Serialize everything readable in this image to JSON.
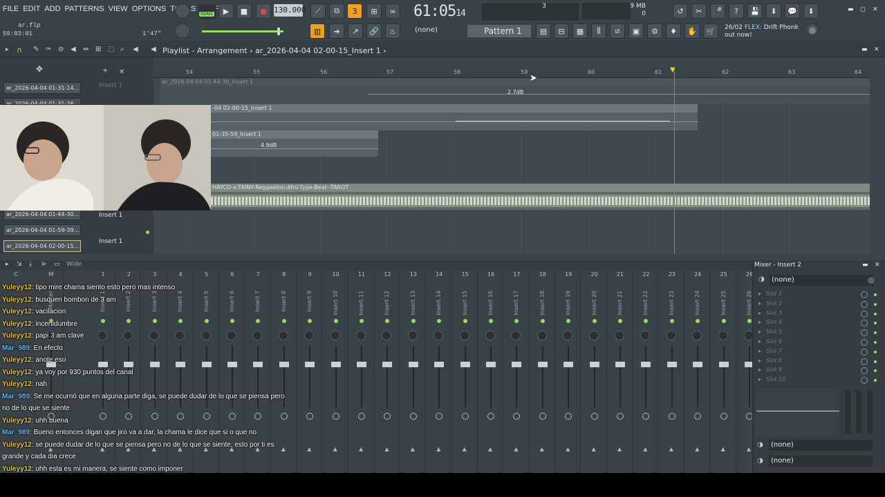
{
  "menu": [
    "FILE",
    "EDIT",
    "ADD",
    "PATTERNS",
    "VIEW",
    "OPTIONS",
    "TOOLS",
    "HELP"
  ],
  "file": {
    "name": "ar.flp",
    "time": "59:03:01",
    "length": "1'47\""
  },
  "transport": {
    "mode": "SONG",
    "tempo": "130.000",
    "clock_main": "61:05",
    "clock_sub": "14"
  },
  "memory": {
    "cpu": "3",
    "ram": "779 MB",
    "poly": "0"
  },
  "pattern": {
    "label": "Pattern 1",
    "preset": "(none)"
  },
  "hint": {
    "date": "26/02",
    "tag": "FLEX:",
    "text": "Drift Phonk",
    "text2": "out now!"
  },
  "playlist": {
    "title": "Playlist - Arrangement",
    "breadcrumb": "ar_2026-04-04 02-00-15_Insert 1",
    "ruler": [
      "54",
      "55",
      "56",
      "57",
      "58",
      "59",
      "60",
      "61",
      "62",
      "63",
      "64"
    ],
    "tracks_side": [
      "ar_2026-04-04 01-31-14...",
      "ar_2026-04-04 01-31-26",
      "ar_2026-04-04 01-44-30...",
      "ar_2026-04-04 01-59-39...",
      "ar_2026-04-04 02-00-15..."
    ],
    "track_labels": [
      "Insert 1",
      "Insert 1",
      "Insert 1"
    ],
    "clips": [
      {
        "name": "ar_2026-04-04 01-44-30_Insert 1",
        "db": "2.7dB"
      },
      {
        "name": "-04 02-00-15_Insert 1"
      },
      {
        "name": "01-35-59_Insert 1",
        "db": "4.9dB"
      },
      {
        "name": "HAYCO-x-TAINY-Reggaeton-Afro-Type-Beat--TAROT"
      }
    ]
  },
  "mixer": {
    "wide_label": "Wide",
    "header": [
      "C",
      "M",
      "1",
      "2",
      "3",
      "4",
      "5",
      "6",
      "7",
      "8",
      "9",
      "10",
      "11",
      "12",
      "13",
      "14",
      "15",
      "16",
      "17",
      "18",
      "19",
      "20",
      "21",
      "22",
      "23",
      "24",
      "25",
      "26"
    ],
    "names": [
      "Master",
      "Insert 1",
      "Insert 2",
      "Insert 3",
      "Insert 4",
      "Insert 5",
      "Insert 6",
      "Insert 7",
      "Insert 8",
      "Insert 9",
      "Insert 10",
      "Insert 11",
      "Insert 12",
      "Insert 13",
      "Insert 14",
      "Insert 15",
      "Insert 16",
      "Insert 17",
      "Insert 18",
      "Insert 19",
      "Insert 20",
      "Insert 21",
      "Insert 22",
      "Insert 23",
      "Insert 24",
      "Insert 25",
      "Insert 26"
    ],
    "panel_title": "Mixer - Insert 2",
    "panel_preset": "(none)",
    "slots": [
      "Slot 1",
      "Slot 2",
      "Slot 3",
      "Slot 4",
      "Slot 5",
      "Slot 6",
      "Slot 7",
      "Slot 8",
      "Slot 9",
      "Slot 10"
    ],
    "out1": "(none)",
    "out2": "(none)"
  },
  "chat": [
    {
      "user": "Yuleyy12",
      "color": "#e7c33a",
      "text": ": tipo mire chama siento esto pero mas intenso"
    },
    {
      "user": "Yuleyy12",
      "color": "#e7c33a",
      "text": ": busquen bombon de 3 am"
    },
    {
      "user": "Yuleyy12",
      "color": "#e7c33a",
      "text": ": vacilacion"
    },
    {
      "user": "Yuleyy12",
      "color": "#e7c33a",
      "text": ": incertidumbre"
    },
    {
      "user": "Yuleyy12",
      "color": "#e7c33a",
      "text": ": papi 3 am clave"
    },
    {
      "user": "Mar_989",
      "color": "#6fb3e8",
      "text": ": En efecto"
    },
    {
      "user": "Yuleyy12",
      "color": "#e7c33a",
      "text": ": anote eso"
    },
    {
      "user": "Yuleyy12",
      "color": "#e7c33a",
      "text": ": ya voy por 930 puntos del canal"
    },
    {
      "user": "Yuleyy12",
      "color": "#e7c33a",
      "text": ": nah"
    },
    {
      "user": "Mar_989",
      "color": "#6fb3e8",
      "text": ": Se me ocurrió que en alguna parte diga, se puede dudar de lo que se piensa pero no de lo que se siente"
    },
    {
      "user": "Yuleyy12",
      "color": "#e7c33a",
      "text": ": uhh buena"
    },
    {
      "user": "Mar_989",
      "color": "#6fb3e8",
      "text": ": Bueno entonces digan que jiro va a dar, la chama le dice que si o que no"
    },
    {
      "user": "Yuleyy12",
      "color": "#e7c33a",
      "text": ": se puede dudar de lo que se piensa pero no de lo que se siente, esto por ti es grande y cada dia crece"
    },
    {
      "user": "Yuleyy12",
      "color": "#e7c33a",
      "text": ": uhh esta es mi manera, se siente como imponer"
    }
  ]
}
